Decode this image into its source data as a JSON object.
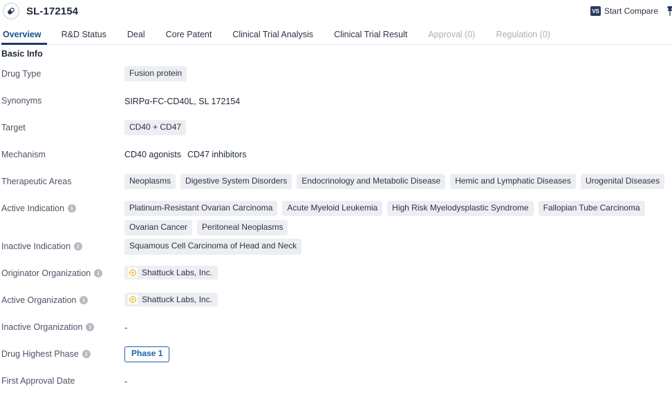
{
  "header": {
    "drug_icon": "capsule-icon",
    "title": "SL-172154",
    "compare_button": "Start Compare",
    "compare_icon_text": "VS"
  },
  "tabs": [
    {
      "label": "Overview",
      "active": true,
      "disabled": false
    },
    {
      "label": "R&D Status",
      "active": false,
      "disabled": false
    },
    {
      "label": "Deal",
      "active": false,
      "disabled": false
    },
    {
      "label": "Core Patent",
      "active": false,
      "disabled": false
    },
    {
      "label": "Clinical Trial Analysis",
      "active": false,
      "disabled": false
    },
    {
      "label": "Clinical Trial Result",
      "active": false,
      "disabled": false
    },
    {
      "label": "Approval (0)",
      "active": false,
      "disabled": true
    },
    {
      "label": "Regulation (0)",
      "active": false,
      "disabled": true
    }
  ],
  "section": {
    "title": "Basic Info"
  },
  "rows": {
    "drug_type": {
      "label": "Drug Type",
      "chips": [
        "Fusion protein"
      ]
    },
    "synonyms": {
      "label": "Synonyms",
      "text": "SIRPα-FC-CD40L,  SL 172154"
    },
    "target": {
      "label": "Target",
      "chips": [
        "CD40 + CD47"
      ]
    },
    "mechanism": {
      "label": "Mechanism",
      "items": [
        "CD40 agonists",
        "CD47 inhibitors"
      ]
    },
    "therapeutic_areas": {
      "label": "Therapeutic Areas",
      "chips": [
        "Neoplasms",
        "Digestive System Disorders",
        "Endocrinology and Metabolic Disease",
        "Hemic and Lymphatic Diseases",
        "Urogenital Diseases"
      ]
    },
    "active_indication": {
      "label": "Active Indication",
      "has_info": true,
      "chips": [
        "Platinum-Resistant Ovarian Carcinoma",
        "Acute Myeloid Leukemia",
        "High Risk Myelodysplastic Syndrome",
        "Fallopian Tube Carcinoma",
        "Ovarian Cancer",
        "Peritoneal Neoplasms"
      ]
    },
    "inactive_indication": {
      "label": "Inactive Indication",
      "has_info": true,
      "chips": [
        "Squamous Cell Carcinoma of Head and Neck"
      ]
    },
    "originator_organization": {
      "label": "Originator Organization",
      "has_info": true,
      "orgs": [
        "Shattuck Labs, Inc."
      ]
    },
    "active_organization": {
      "label": "Active Organization",
      "has_info": true,
      "orgs": [
        "Shattuck Labs, Inc."
      ]
    },
    "inactive_organization": {
      "label": "Inactive Organization",
      "has_info": true,
      "value": "-"
    },
    "drug_highest_phase": {
      "label": "Drug Highest Phase",
      "has_info": true,
      "badge": "Phase 1"
    },
    "first_approval_date": {
      "label": "First Approval Date",
      "has_info": false,
      "value": "-"
    }
  },
  "colors": {
    "accent": "#1b3a6b",
    "active_tab_text": "#17528f",
    "chip_bg": "#eceef2",
    "phase_blue": "#1f5fa8",
    "label_text": "#4b5464",
    "disabled_tab": "#a9aeb8"
  }
}
